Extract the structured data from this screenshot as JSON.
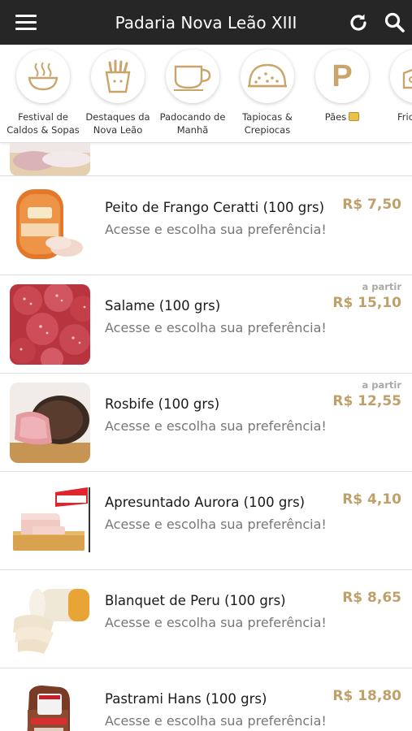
{
  "header": {
    "title": "Padaria Nova Leão XIII",
    "menu_icon": "hamburger-menu-icon",
    "refresh_icon": "refresh-icon",
    "search_icon": "search-icon"
  },
  "categories": [
    {
      "label": "Festival de Caldos & Sopas",
      "icon": "soup-bowl-icon"
    },
    {
      "label": "Destaques da Nova Leão",
      "icon": "fries-icon"
    },
    {
      "label": "Padocando de Manhã",
      "icon": "coffee-cup-icon"
    },
    {
      "label": "Tapiocas & Crepiocas",
      "icon": "tapioca-icon"
    },
    {
      "label": "Pães",
      "icon": "letter-p-icon",
      "letter": "P"
    },
    {
      "label": "Frios",
      "icon": "cheese-icon"
    }
  ],
  "products": [
    {
      "name": "Peito de Frango Ceratti (100 grs)",
      "desc": "Acesse e escolha sua preferência!",
      "from": "",
      "price": "R$ 7,50"
    },
    {
      "name": "Salame (100 grs)",
      "desc": "Acesse e escolha sua preferência!",
      "from": "a partir",
      "price": "R$ 15,10"
    },
    {
      "name": "Rosbife (100 grs)",
      "desc": "Acesse e escolha sua preferência!",
      "from": "a partir",
      "price": "R$ 12,55"
    },
    {
      "name": "Apresuntado Aurora (100 grs)",
      "desc": "Acesse e escolha sua preferência!",
      "from": "",
      "price": "R$ 4,10"
    },
    {
      "name": "Blanquet de Peru (100 grs)",
      "desc": "Acesse e escolha sua preferência!",
      "from": "",
      "price": "R$ 8,65"
    },
    {
      "name": "Pastrami Hans (100 grs)",
      "desc": "Acesse e escolha sua preferência!",
      "from": "",
      "price": "R$ 18,80"
    }
  ],
  "colors": {
    "header_bg": "#262626",
    "accent_gold": "#c0a06a",
    "icon_gold": "#c9a56b"
  }
}
